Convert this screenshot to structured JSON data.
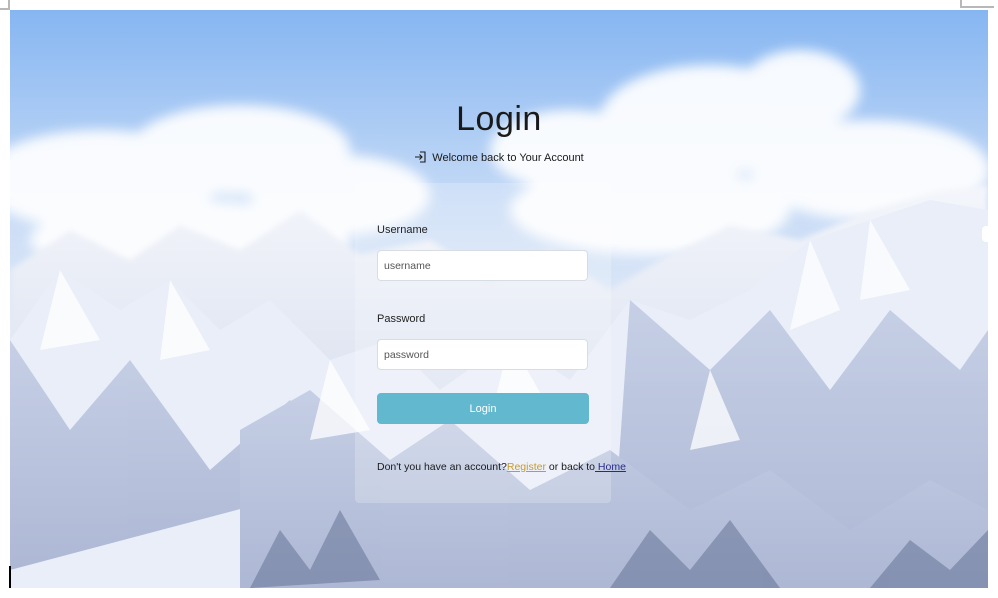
{
  "page": {
    "title": "Login",
    "subtitle": "Welcome back to Your Account"
  },
  "form": {
    "username_label": "Username",
    "username_placeholder": "username",
    "password_label": "Password",
    "password_placeholder": "password",
    "submit_label": "Login"
  },
  "footer": {
    "prompt": "Don't you have an account?",
    "register_link": "Register",
    "middle": " or back to",
    "home_link": " Home"
  },
  "colors": {
    "button": "#62b8cf",
    "register_link": "#c89a2a",
    "home_link": "#2a2a8a",
    "sky_top": "#8fbdf5"
  },
  "icons": {
    "subtitle_icon": "login-icon"
  }
}
